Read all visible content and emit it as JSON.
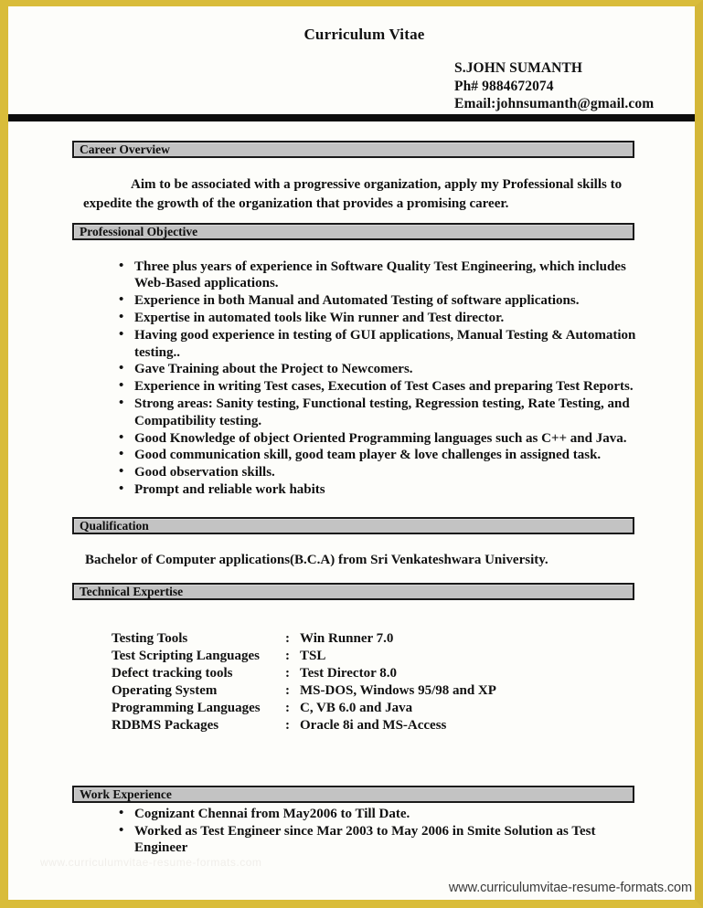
{
  "document": {
    "title": "Curriculum Vitae",
    "accent_gold": "#d9bc3a",
    "section_bar_fill": "#c3c3c3",
    "rule_color": "#0d0d0d"
  },
  "contact": {
    "name": "S.JOHN SUMANTH",
    "phone": "Ph# 9884672074",
    "email": "Email:johnsumanth@gmail.com"
  },
  "sections": {
    "career_overview": {
      "heading": "Career Overview",
      "paragraph": "Aim to be associated with a progressive organization, apply my Professional skills to expedite the growth of the organization that provides a promising career."
    },
    "professional_objective": {
      "heading": "Professional Objective",
      "bullets": [
        "Three plus years of experience in Software Quality Test Engineering, which includes Web-Based applications.",
        "Experience in both Manual and Automated Testing of software applications.",
        "Expertise in automated tools like Win runner and Test director.",
        "Having good experience in testing of GUI applications, Manual Testing & Automation testing..",
        "Gave Training about the Project to Newcomers.",
        "Experience in writing Test cases, Execution of Test Cases and preparing Test Reports.",
        "Strong areas: Sanity testing, Functional testing, Regression testing, Rate Testing, and Compatibility testing.",
        "Good Knowledge of object Oriented Programming languages such as C++ and Java.",
        "Good communication skill, good team player & love challenges in assigned task.",
        "Good observation skills.",
        "Prompt and reliable work habits"
      ]
    },
    "qualification": {
      "heading": "Qualification",
      "paragraph": "Bachelor of Computer applications(B.C.A)  from Sri Venkateshwara University."
    },
    "technical_expertise": {
      "heading": "Technical Expertise",
      "separator": ":",
      "rows": [
        {
          "key": "Testing Tools",
          "value": " Win Runner 7.0"
        },
        {
          "key": "Test Scripting Languages",
          "value": " TSL"
        },
        {
          "key": "Defect tracking tools",
          "value": " Test Director 8.0"
        },
        {
          "key": "Operating System",
          "value": "MS-DOS, Windows 95/98 and XP"
        },
        {
          "key": "Programming Languages",
          "value": " C, VB 6.0 and Java"
        },
        {
          "key": "RDBMS Packages",
          "value": " Oracle 8i and MS-Access"
        }
      ]
    },
    "work_experience": {
      "heading": "Work Experience",
      "bullets": [
        "Cognizant Chennai from May2006 to Till Date.",
        "Worked as Test Engineer since Mar 2003 to May 2006 in Smite Solution as Test Engineer"
      ]
    }
  },
  "watermark": {
    "text": "www.curriculumvitae-resume-formats.com"
  },
  "footer": {
    "url": "www.curriculumvitae-resume-formats.com"
  }
}
